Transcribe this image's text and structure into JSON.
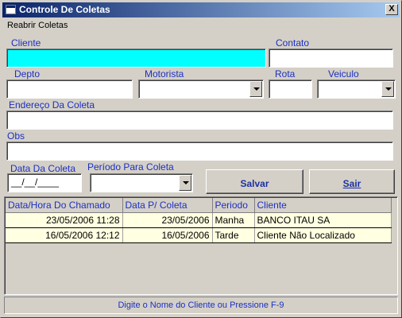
{
  "window": {
    "title": "Controle De Coletas",
    "close_label": "X"
  },
  "menu": {
    "reabrir": "Reabrir Coletas"
  },
  "labels": {
    "cliente": "Cliente",
    "contato": "Contato",
    "depto": "Depto",
    "motorista": "Motorista",
    "rota": "Rota",
    "veiculo": "Veiculo",
    "endereco": "Endereço Da Coleta",
    "obs": "Obs",
    "data_coleta": "Data Da Coleta",
    "periodo": "Período Para Coleta"
  },
  "fields": {
    "cliente": "",
    "contato": "",
    "depto": "",
    "motorista": "",
    "rota": "",
    "veiculo": "",
    "endereco": "",
    "obs": "",
    "data_coleta": "__/__/____",
    "periodo": ""
  },
  "buttons": {
    "salvar": "Salvar",
    "sair": "Sair"
  },
  "table": {
    "columns": [
      "Data/Hora Do Chamado",
      "Data P/ Coleta",
      "Periodo",
      "Cliente"
    ],
    "rows": [
      [
        "23/05/2006 11:28",
        "23/05/2006",
        "Manha",
        "BANCO ITAU SA"
      ],
      [
        "16/05/2006 12:12",
        "16/05/2006",
        "Tarde",
        "Cliente Não Localizado"
      ]
    ]
  },
  "status": "Digite o Nome do Cliente ou Pressione F-9",
  "colors": {
    "title_start": "#0a246a",
    "title_end": "#a6caf0",
    "label": "#1c30c0",
    "active_field": "#00ffff",
    "row_bg": "#ffffe1"
  }
}
